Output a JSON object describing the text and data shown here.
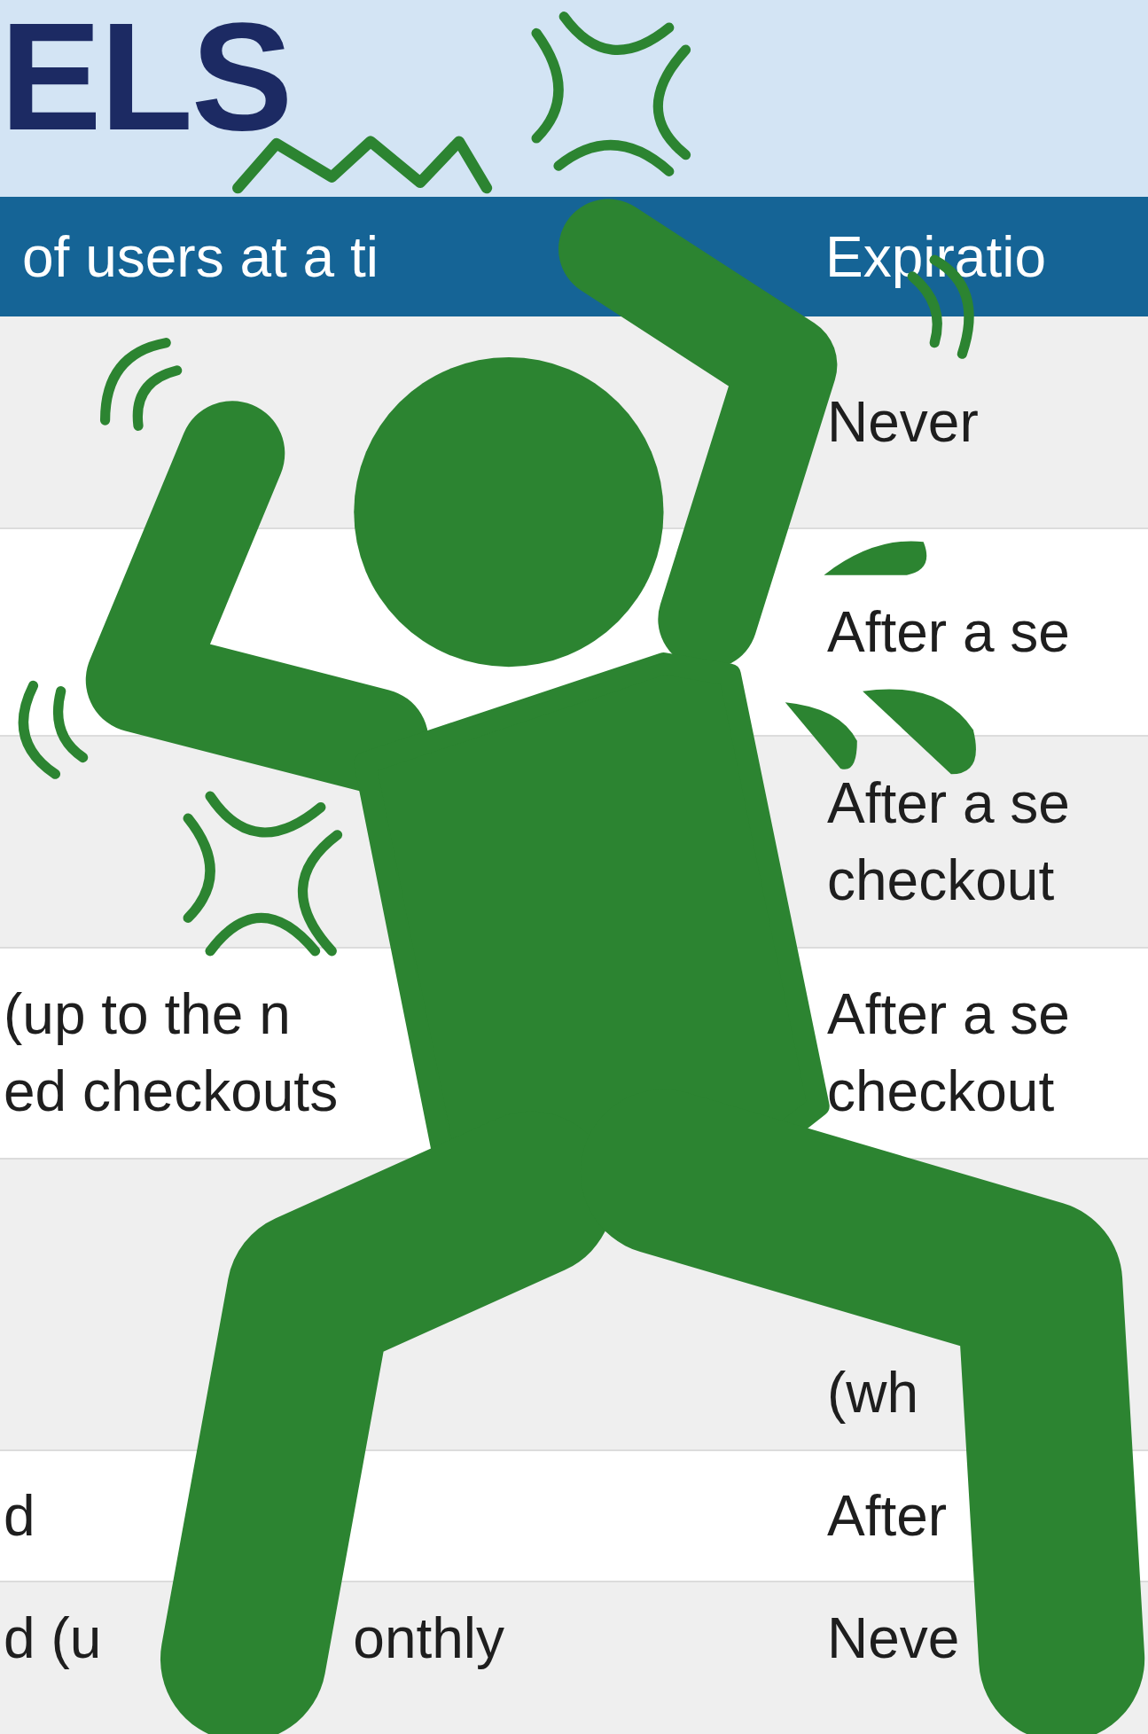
{
  "title": "ELS",
  "table": {
    "columns": [
      "of users at a ti",
      "Expiratio"
    ],
    "rows": [
      {
        "column_2": "Never"
      },
      {
        "column_2": "After a se"
      },
      {
        "column_2": "After a se\ncheckout"
      },
      {
        "column_1": "(up to the n\ned checkouts",
        "column_2": "After a se\ncheckout"
      },
      {
        "column_2": "(wh"
      },
      {
        "column_1": "d",
        "column_2": "After"
      },
      {
        "column_1": [
          "d (u",
          "onthly"
        ],
        "column_2": "Neve"
      }
    ]
  }
}
